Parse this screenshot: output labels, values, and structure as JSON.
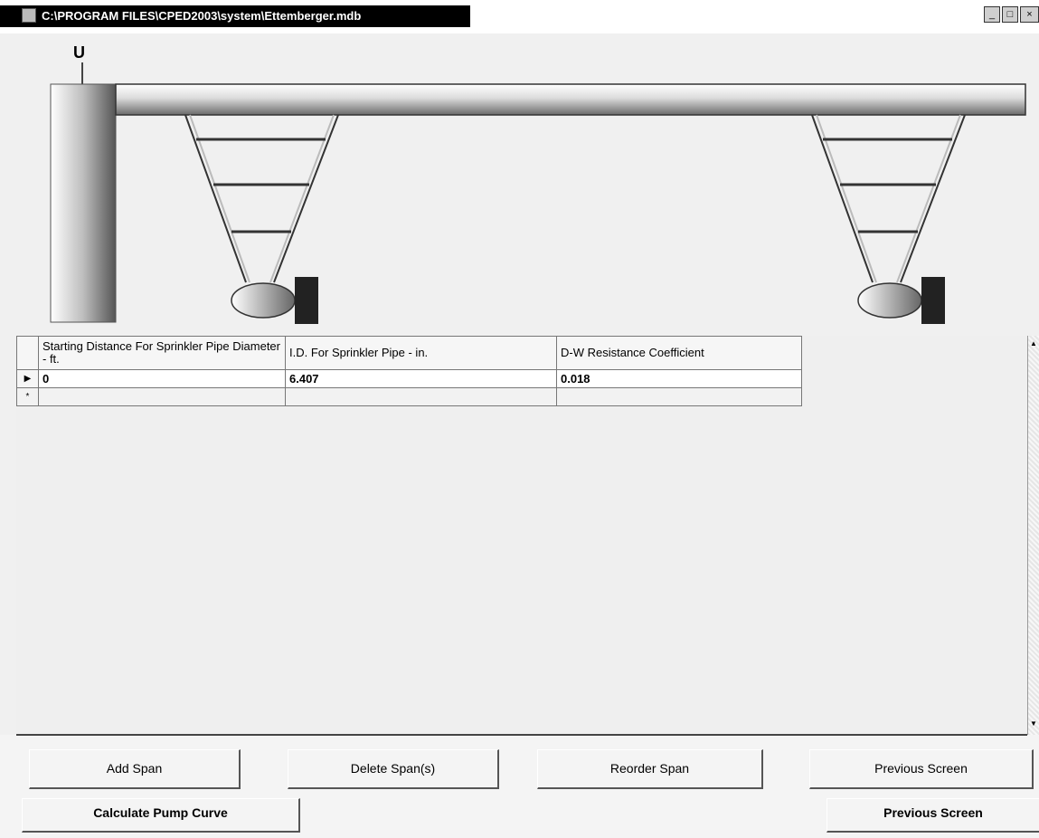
{
  "window": {
    "title": "C:\\PROGRAM FILES\\CPED2003\\system\\Ettemberger.mdb",
    "controls": {
      "minimize": "_",
      "maximize": "□",
      "close": "×"
    }
  },
  "drawing": {
    "pivot_symbol": "U",
    "colors": {
      "pipe_dark": "#555555",
      "pipe_light": "#ffffff",
      "wheel": "#222222"
    }
  },
  "grid": {
    "columns": [
      "Starting Distance For Sprinkler Pipe Diameter - ft.",
      "I.D. For Sprinkler Pipe - in.",
      "D-W Resistance Coefficient"
    ],
    "rows": [
      {
        "indicator": "▶",
        "cells": [
          "0",
          "6.407",
          "0.018"
        ]
      },
      {
        "indicator": "*",
        "cells": [
          "",
          "",
          ""
        ]
      }
    ]
  },
  "buttons_row1": [
    "Add Span",
    "Delete Span(s)",
    "Reorder Span",
    "Previous Screen"
  ],
  "buttons_row2": {
    "calculate": "Calculate Pump Curve",
    "previous": "Previous Screen"
  }
}
